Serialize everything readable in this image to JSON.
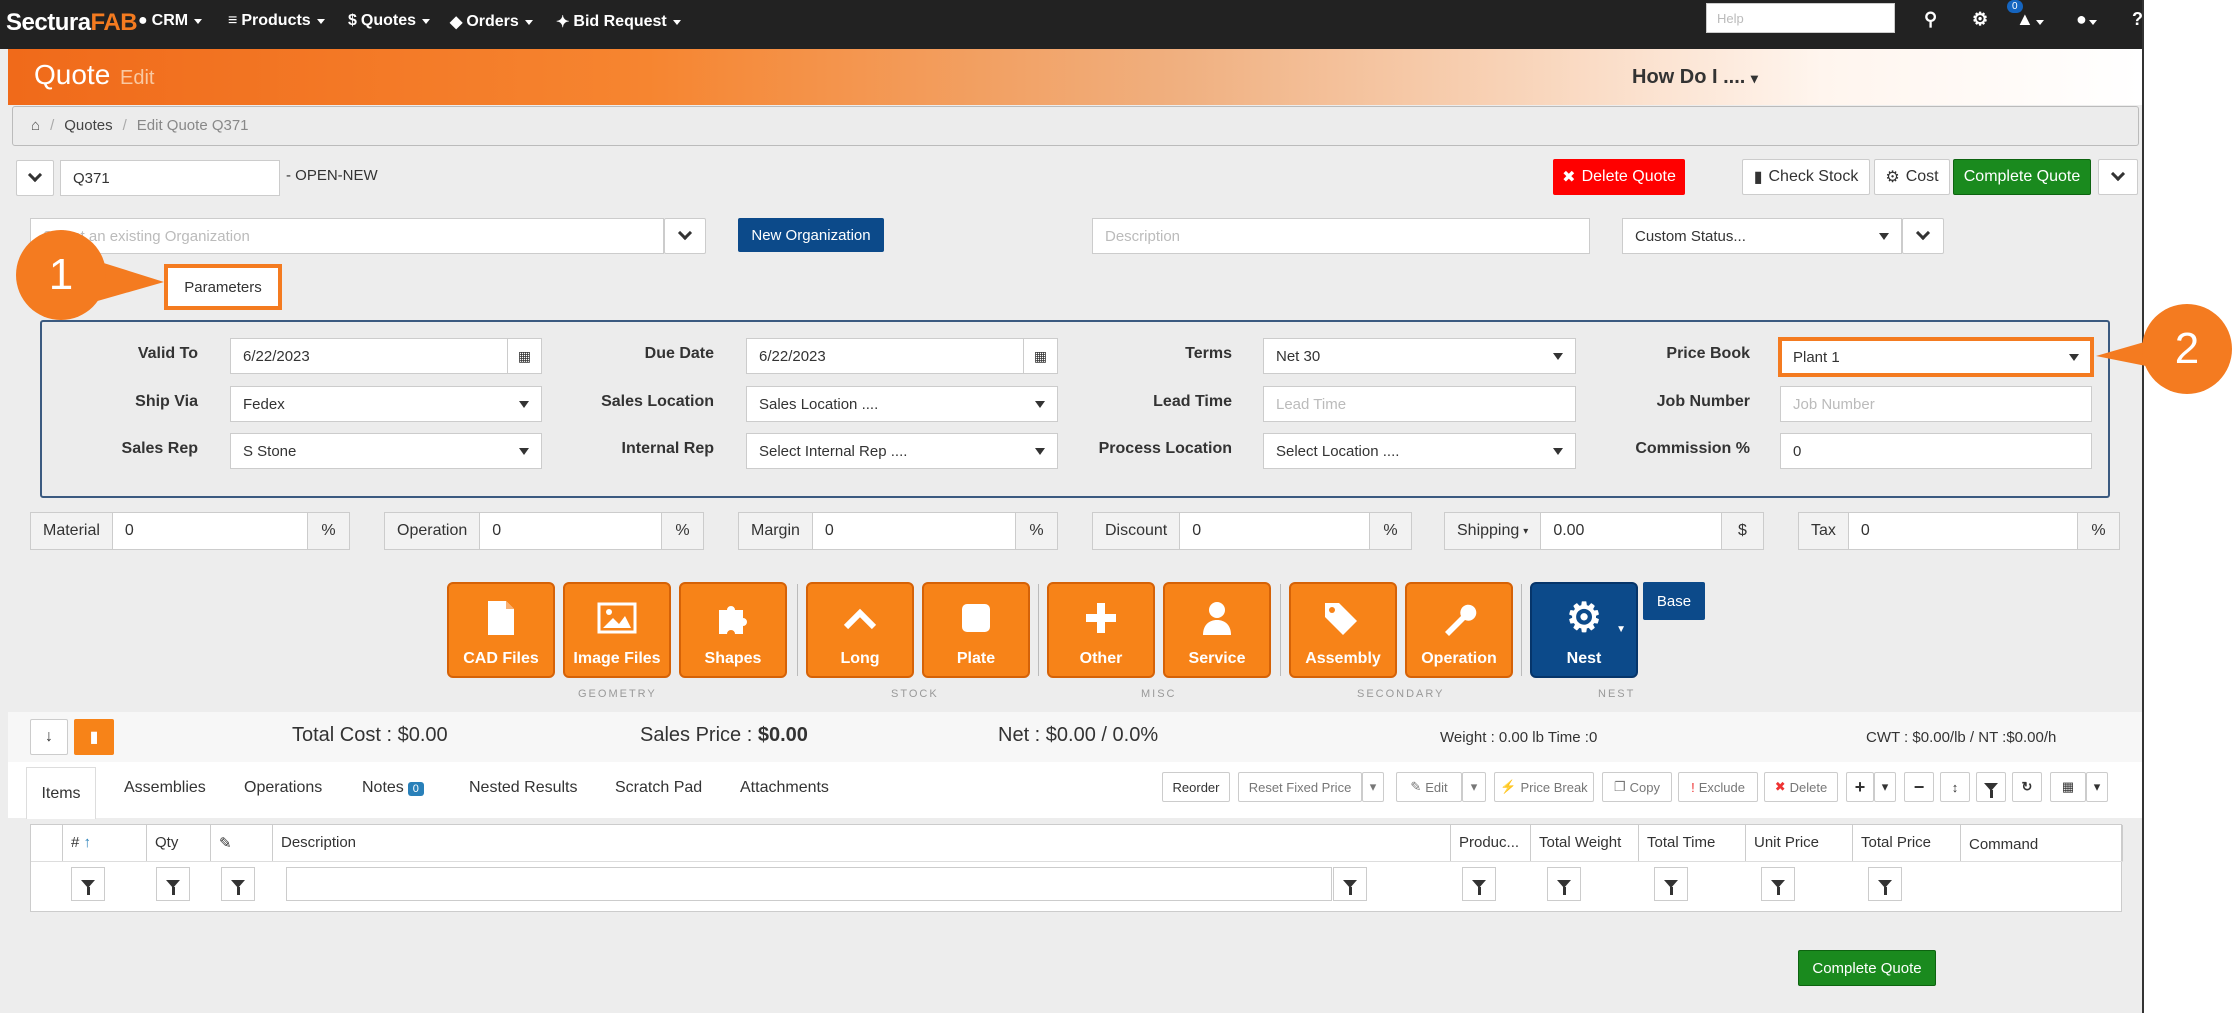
{
  "navbar": {
    "brand_a": "Sectura",
    "brand_b": "FAB",
    "items": [
      "CRM",
      "Products",
      "Quotes",
      "Orders",
      "Bid Request"
    ],
    "help_placeholder": "Help",
    "notification_count": "0"
  },
  "header": {
    "title": "Quote",
    "subtitle": "Edit",
    "howdo": "How Do I ....",
    "breadcrumb": [
      "Quotes",
      "Edit Quote Q371"
    ]
  },
  "quote": {
    "id": "Q371",
    "status": "- OPEN-NEW"
  },
  "actions": {
    "delete": "Delete Quote",
    "check_stock": "Check Stock",
    "cost": "Cost",
    "complete": "Complete Quote"
  },
  "org": {
    "placeholder": "Select an existing Organization",
    "new_org": "New Organization",
    "description_placeholder": "Description",
    "custom_status": "Custom Status..."
  },
  "tabs_top": {
    "parameters": "Parameters"
  },
  "params": {
    "valid_to_label": "Valid To",
    "valid_to": "6/22/2023",
    "due_date_label": "Due Date",
    "due_date": "6/22/2023",
    "terms_label": "Terms",
    "terms": "Net 30",
    "price_book_label": "Price Book",
    "price_book": "Plant 1",
    "ship_via_label": "Ship Via",
    "ship_via": "Fedex",
    "sales_location_label": "Sales Location",
    "sales_location": "Sales Location ....",
    "lead_time_label": "Lead Time",
    "lead_time_placeholder": "Lead Time",
    "job_number_label": "Job Number",
    "job_number_placeholder": "Job Number",
    "sales_rep_label": "Sales Rep",
    "sales_rep": "S Stone",
    "internal_rep_label": "Internal Rep",
    "internal_rep": "Select Internal Rep ....",
    "process_location_label": "Process Location",
    "process_location": "Select Location ....",
    "commission_label": "Commission %",
    "commission": "0"
  },
  "callouts": [
    "1",
    "2"
  ],
  "pct": [
    {
      "label": "Material",
      "value": "0",
      "unit": "%"
    },
    {
      "label": "Operation",
      "value": "0",
      "unit": "%"
    },
    {
      "label": "Margin",
      "value": "0",
      "unit": "%"
    },
    {
      "label": "Discount",
      "value": "0",
      "unit": "%"
    },
    {
      "label": "Shipping",
      "value": "0.00",
      "unit": "$"
    },
    {
      "label": "Tax",
      "value": "0",
      "unit": "%"
    }
  ],
  "tiles": [
    "CAD Files",
    "Image Files",
    "Shapes",
    "Long",
    "Plate",
    "Other",
    "Service",
    "Assembly",
    "Operation",
    "Nest"
  ],
  "tile_groups": [
    "GEOMETRY",
    "STOCK",
    "MISC",
    "SECONDARY",
    "NEST"
  ],
  "base_button": "Base",
  "totals": {
    "total_cost_label": "Total Cost :",
    "total_cost": "$0.00",
    "sales_price_label": "Sales Price :",
    "sales_price": "$0.00",
    "net": "Net : $0.00 / 0.0%",
    "weight": "Weight : 0.00 lb Time :0",
    "cwt": "CWT : $0.00/lb / NT :$0.00/h"
  },
  "item_tabs": [
    "Items",
    "Assemblies",
    "Operations",
    "Notes",
    "Nested Results",
    "Scratch Pad",
    "Attachments"
  ],
  "notes_count": "0",
  "toolbar": [
    "Reorder",
    "Reset Fixed Price",
    "Edit",
    "Price Break",
    "Copy",
    "Exclude",
    "Delete"
  ],
  "grid_headers": [
    "#",
    "Qty",
    "",
    "Description",
    "Produc...",
    "Total Weight",
    "Total Time",
    "Unit Price",
    "Total Price",
    "Command"
  ],
  "bottom_complete": "Complete Quote"
}
